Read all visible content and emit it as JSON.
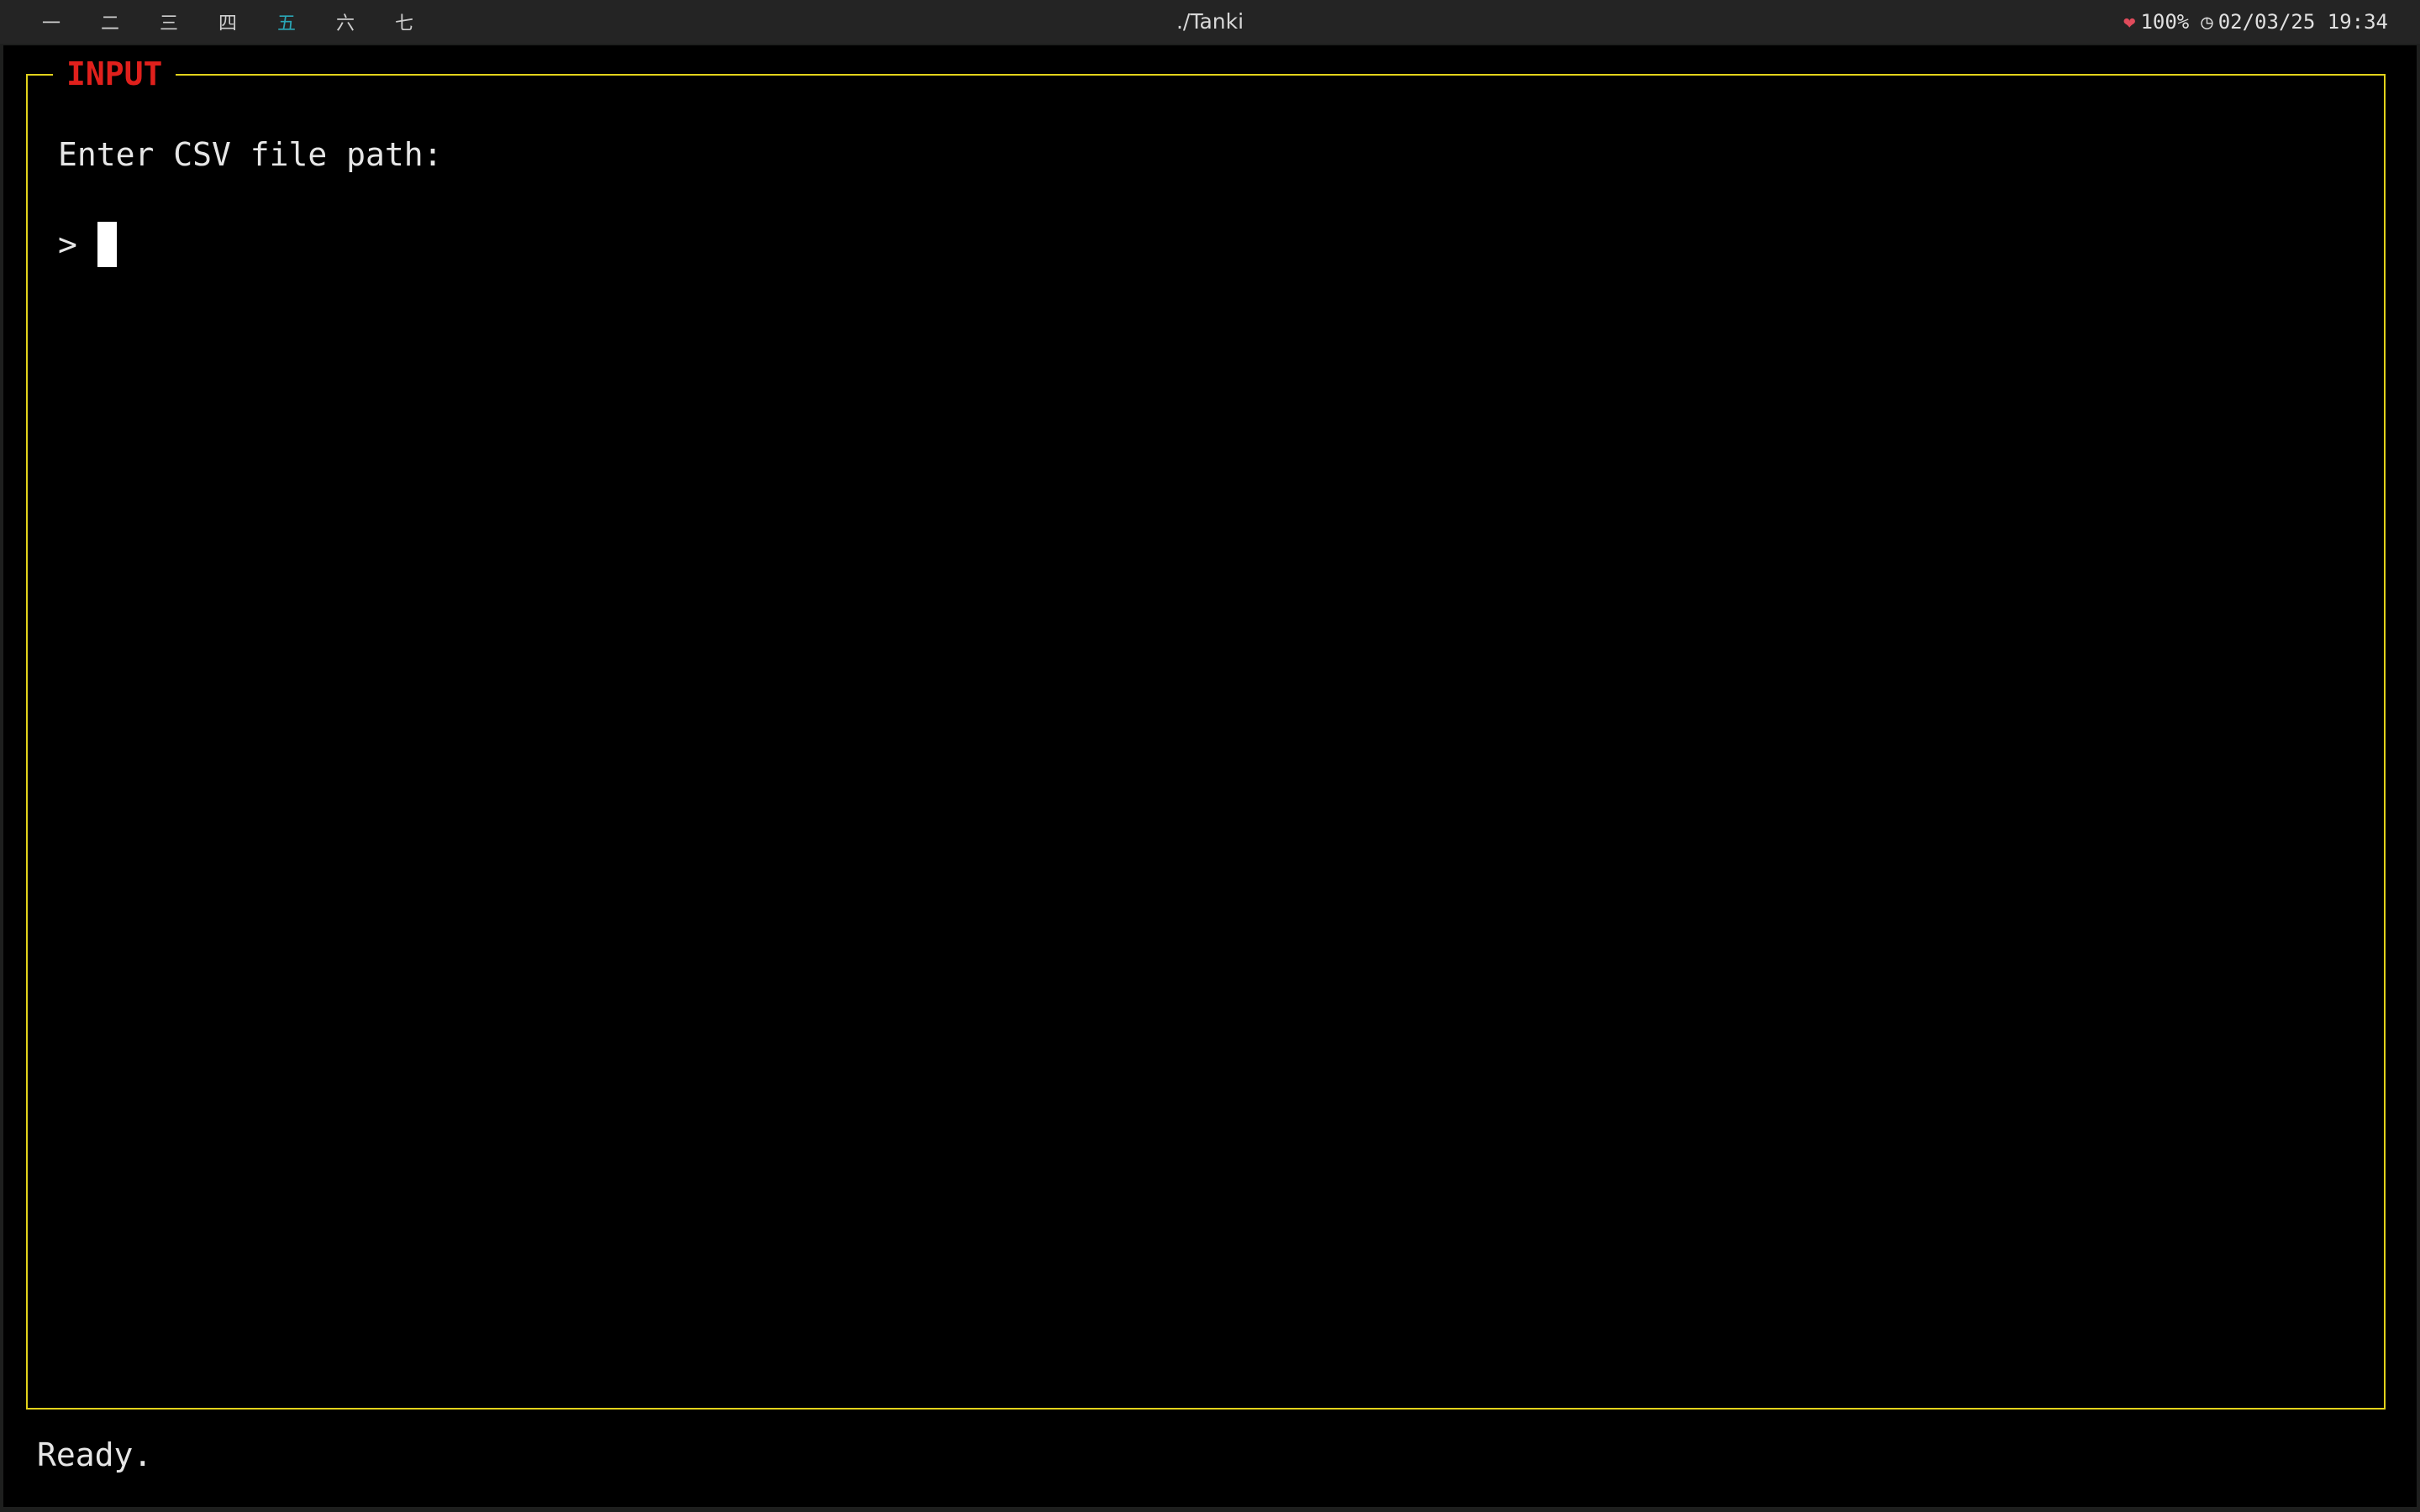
{
  "topbar": {
    "workspaces": [
      {
        "label": "一",
        "active": false
      },
      {
        "label": "二",
        "active": false
      },
      {
        "label": "三",
        "active": false
      },
      {
        "label": "四",
        "active": false
      },
      {
        "label": "五",
        "active": true
      },
      {
        "label": "六",
        "active": false
      },
      {
        "label": "七",
        "active": false
      }
    ],
    "window_title": "./Tanki",
    "battery_icon": "heart-icon",
    "battery": "100%",
    "clock_icon": "clock-icon",
    "datetime": "02/03/25 19:34"
  },
  "panel": {
    "title": "INPUT",
    "prompt": "Enter CSV file path:",
    "prompt_symbol": ">",
    "input_value": ""
  },
  "status": {
    "message": "Ready."
  },
  "colors": {
    "frame": "#e2d21b",
    "title": "#e0201c",
    "active_workspace": "#2aa6b6",
    "terminal_bg": "#000000"
  }
}
